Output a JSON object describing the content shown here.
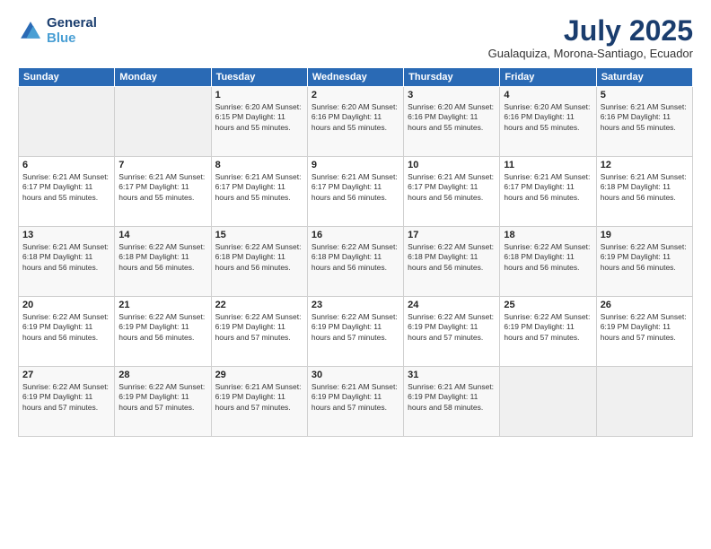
{
  "logo": {
    "line1": "General",
    "line2": "Blue"
  },
  "title": {
    "month_year": "July 2025",
    "location": "Gualaquiza, Morona-Santiago, Ecuador"
  },
  "calendar": {
    "headers": [
      "Sunday",
      "Monday",
      "Tuesday",
      "Wednesday",
      "Thursday",
      "Friday",
      "Saturday"
    ],
    "rows": [
      [
        {
          "day": "",
          "info": ""
        },
        {
          "day": "",
          "info": ""
        },
        {
          "day": "1",
          "info": "Sunrise: 6:20 AM\nSunset: 6:15 PM\nDaylight: 11 hours and 55 minutes."
        },
        {
          "day": "2",
          "info": "Sunrise: 6:20 AM\nSunset: 6:16 PM\nDaylight: 11 hours and 55 minutes."
        },
        {
          "day": "3",
          "info": "Sunrise: 6:20 AM\nSunset: 6:16 PM\nDaylight: 11 hours and 55 minutes."
        },
        {
          "day": "4",
          "info": "Sunrise: 6:20 AM\nSunset: 6:16 PM\nDaylight: 11 hours and 55 minutes."
        },
        {
          "day": "5",
          "info": "Sunrise: 6:21 AM\nSunset: 6:16 PM\nDaylight: 11 hours and 55 minutes."
        }
      ],
      [
        {
          "day": "6",
          "info": "Sunrise: 6:21 AM\nSunset: 6:17 PM\nDaylight: 11 hours and 55 minutes."
        },
        {
          "day": "7",
          "info": "Sunrise: 6:21 AM\nSunset: 6:17 PM\nDaylight: 11 hours and 55 minutes."
        },
        {
          "day": "8",
          "info": "Sunrise: 6:21 AM\nSunset: 6:17 PM\nDaylight: 11 hours and 55 minutes."
        },
        {
          "day": "9",
          "info": "Sunrise: 6:21 AM\nSunset: 6:17 PM\nDaylight: 11 hours and 56 minutes."
        },
        {
          "day": "10",
          "info": "Sunrise: 6:21 AM\nSunset: 6:17 PM\nDaylight: 11 hours and 56 minutes."
        },
        {
          "day": "11",
          "info": "Sunrise: 6:21 AM\nSunset: 6:17 PM\nDaylight: 11 hours and 56 minutes."
        },
        {
          "day": "12",
          "info": "Sunrise: 6:21 AM\nSunset: 6:18 PM\nDaylight: 11 hours and 56 minutes."
        }
      ],
      [
        {
          "day": "13",
          "info": "Sunrise: 6:21 AM\nSunset: 6:18 PM\nDaylight: 11 hours and 56 minutes."
        },
        {
          "day": "14",
          "info": "Sunrise: 6:22 AM\nSunset: 6:18 PM\nDaylight: 11 hours and 56 minutes."
        },
        {
          "day": "15",
          "info": "Sunrise: 6:22 AM\nSunset: 6:18 PM\nDaylight: 11 hours and 56 minutes."
        },
        {
          "day": "16",
          "info": "Sunrise: 6:22 AM\nSunset: 6:18 PM\nDaylight: 11 hours and 56 minutes."
        },
        {
          "day": "17",
          "info": "Sunrise: 6:22 AM\nSunset: 6:18 PM\nDaylight: 11 hours and 56 minutes."
        },
        {
          "day": "18",
          "info": "Sunrise: 6:22 AM\nSunset: 6:18 PM\nDaylight: 11 hours and 56 minutes."
        },
        {
          "day": "19",
          "info": "Sunrise: 6:22 AM\nSunset: 6:19 PM\nDaylight: 11 hours and 56 minutes."
        }
      ],
      [
        {
          "day": "20",
          "info": "Sunrise: 6:22 AM\nSunset: 6:19 PM\nDaylight: 11 hours and 56 minutes."
        },
        {
          "day": "21",
          "info": "Sunrise: 6:22 AM\nSunset: 6:19 PM\nDaylight: 11 hours and 56 minutes."
        },
        {
          "day": "22",
          "info": "Sunrise: 6:22 AM\nSunset: 6:19 PM\nDaylight: 11 hours and 57 minutes."
        },
        {
          "day": "23",
          "info": "Sunrise: 6:22 AM\nSunset: 6:19 PM\nDaylight: 11 hours and 57 minutes."
        },
        {
          "day": "24",
          "info": "Sunrise: 6:22 AM\nSunset: 6:19 PM\nDaylight: 11 hours and 57 minutes."
        },
        {
          "day": "25",
          "info": "Sunrise: 6:22 AM\nSunset: 6:19 PM\nDaylight: 11 hours and 57 minutes."
        },
        {
          "day": "26",
          "info": "Sunrise: 6:22 AM\nSunset: 6:19 PM\nDaylight: 11 hours and 57 minutes."
        }
      ],
      [
        {
          "day": "27",
          "info": "Sunrise: 6:22 AM\nSunset: 6:19 PM\nDaylight: 11 hours and 57 minutes."
        },
        {
          "day": "28",
          "info": "Sunrise: 6:22 AM\nSunset: 6:19 PM\nDaylight: 11 hours and 57 minutes."
        },
        {
          "day": "29",
          "info": "Sunrise: 6:21 AM\nSunset: 6:19 PM\nDaylight: 11 hours and 57 minutes."
        },
        {
          "day": "30",
          "info": "Sunrise: 6:21 AM\nSunset: 6:19 PM\nDaylight: 11 hours and 57 minutes."
        },
        {
          "day": "31",
          "info": "Sunrise: 6:21 AM\nSunset: 6:19 PM\nDaylight: 11 hours and 58 minutes."
        },
        {
          "day": "",
          "info": ""
        },
        {
          "day": "",
          "info": ""
        }
      ]
    ]
  }
}
